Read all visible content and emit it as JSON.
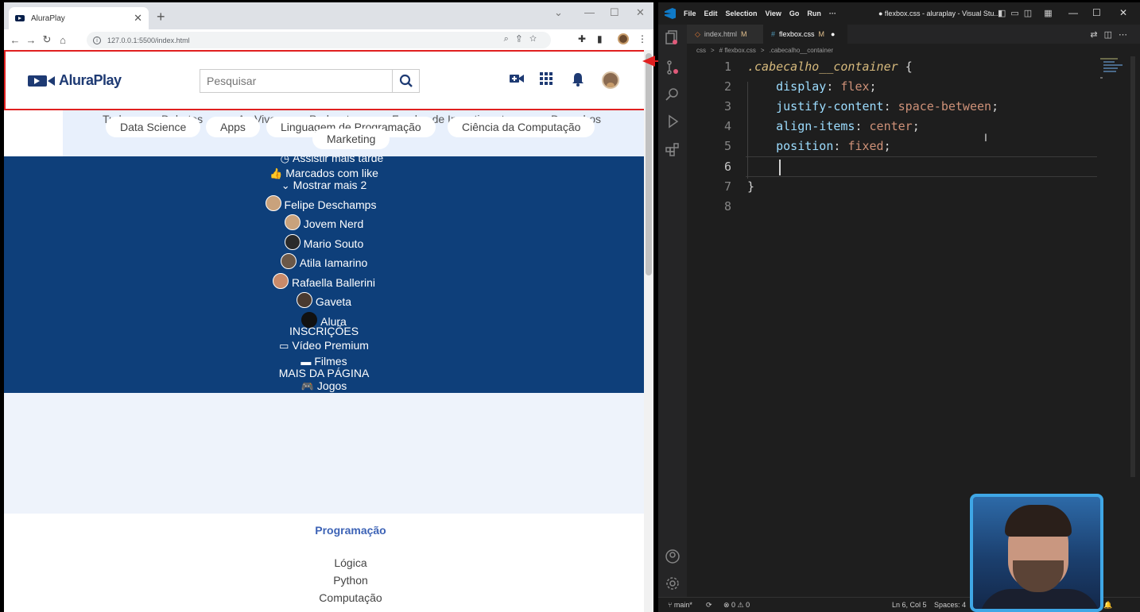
{
  "browser": {
    "tab_title": "AluraPlay",
    "tab_close": "✕",
    "new_tab": "+",
    "url": "127.0.0.1:5500/index.html"
  },
  "site": {
    "logo_text": "AluraPlay",
    "search_placeholder": "Pesquisar",
    "categories_row1": [
      "Tudo",
      "Debates",
      "Ao Vivo",
      "Podcasts",
      "Fundos de Investimento",
      "Desenhos"
    ],
    "categories_row2": [
      "Data Science",
      "Apps",
      "Linguagem de Programação",
      "Ciência da Computação"
    ],
    "categories_row3": [
      "Marketing"
    ],
    "sidebar": {
      "watch_later": "Assistir mais tarde",
      "liked": "Marcados com like",
      "show_more": "Mostrar mais 2",
      "subscriptions": [
        "Felipe Deschamps",
        "Jovem Nerd",
        "Mario Souto",
        "Atila Iamarino",
        "Rafaella Ballerini",
        "Gaveta",
        "Alura"
      ],
      "subscriptions_heading": "INSCRIÇÕES",
      "premium": "Vídeo Premium",
      "movies": "Filmes",
      "more_heading": "MAIS DA PÁGINA",
      "games": "Jogos"
    },
    "footer": {
      "heading": "Programação",
      "links": [
        "Lógica",
        "Python",
        "Computação"
      ]
    }
  },
  "vscode": {
    "menu": [
      "File",
      "Edit",
      "Selection",
      "View",
      "Go",
      "Run",
      "···"
    ],
    "window_title": "● flexbox.css - aluraplay - Visual Stu...",
    "tabs": [
      {
        "label": "index.html",
        "status": "M"
      },
      {
        "label": "flexbox.css",
        "status": "M"
      }
    ],
    "breadcrumb": [
      "css",
      ">",
      "# flexbox.css",
      ">",
      ".cabecalho__container"
    ],
    "code": {
      "selector": ".cabecalho__container",
      "open_brace": "{",
      "close_brace": "}",
      "declarations": [
        {
          "prop": "display",
          "value": "flex"
        },
        {
          "prop": "justify-content",
          "value": "space-between"
        },
        {
          "prop": "align-items",
          "value": "center"
        },
        {
          "prop": "position",
          "value": "fixed"
        }
      ],
      "line_numbers": [
        "1",
        "2",
        "3",
        "4",
        "5",
        "6",
        "7",
        "8"
      ]
    },
    "status": {
      "branch": "main*",
      "errors": "⊗ 0 ⚠ 0",
      "position": "Ln 6, Col 5",
      "spaces": "Spaces: 4"
    }
  },
  "colors": {
    "accent_blue": "#0e3f7a",
    "highlight_red": "#e02020",
    "vscode_bg": "#1e1e1e"
  }
}
